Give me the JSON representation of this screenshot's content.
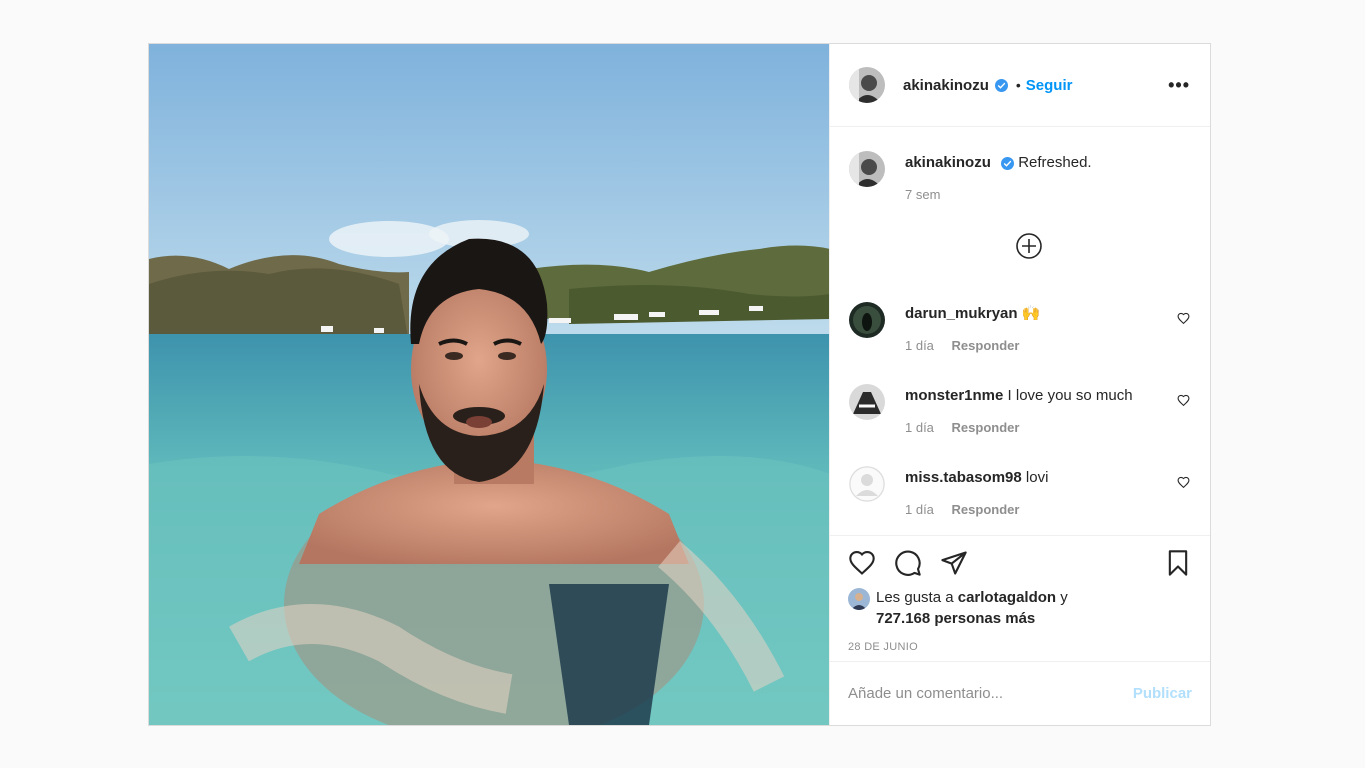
{
  "post": {
    "author": "akinakinozu",
    "follow_label": "Seguir",
    "separator": "•",
    "more_icon": "more-horizontal-icon",
    "caption": {
      "username": "akinakinozu",
      "text": "Refreshed.",
      "time": "7 sem"
    },
    "load_more_icon": "plus-circle-icon",
    "comments": [
      {
        "username": "darun_mukryan",
        "text": "🙌",
        "time": "1 día",
        "reply": "Responder"
      },
      {
        "username": "monster1nme",
        "text": "I love you so much",
        "time": "1 día",
        "reply": "Responder"
      },
      {
        "username": "miss.tabasom98",
        "text": "lovi",
        "time": "1 día",
        "reply": "Responder"
      }
    ],
    "likes": {
      "prefix": "Les gusta a",
      "user": "carlotagaldon",
      "conj": "y",
      "others": "727.168 personas más"
    },
    "date": "28 DE JUNIO",
    "add_comment_placeholder": "Añade un comentario...",
    "publish_label": "Publicar"
  },
  "colors": {
    "accent": "#0095f6",
    "publish_disabled": "#b2dffc",
    "verified": "#3897f0",
    "muted": "#8e8e8e"
  }
}
